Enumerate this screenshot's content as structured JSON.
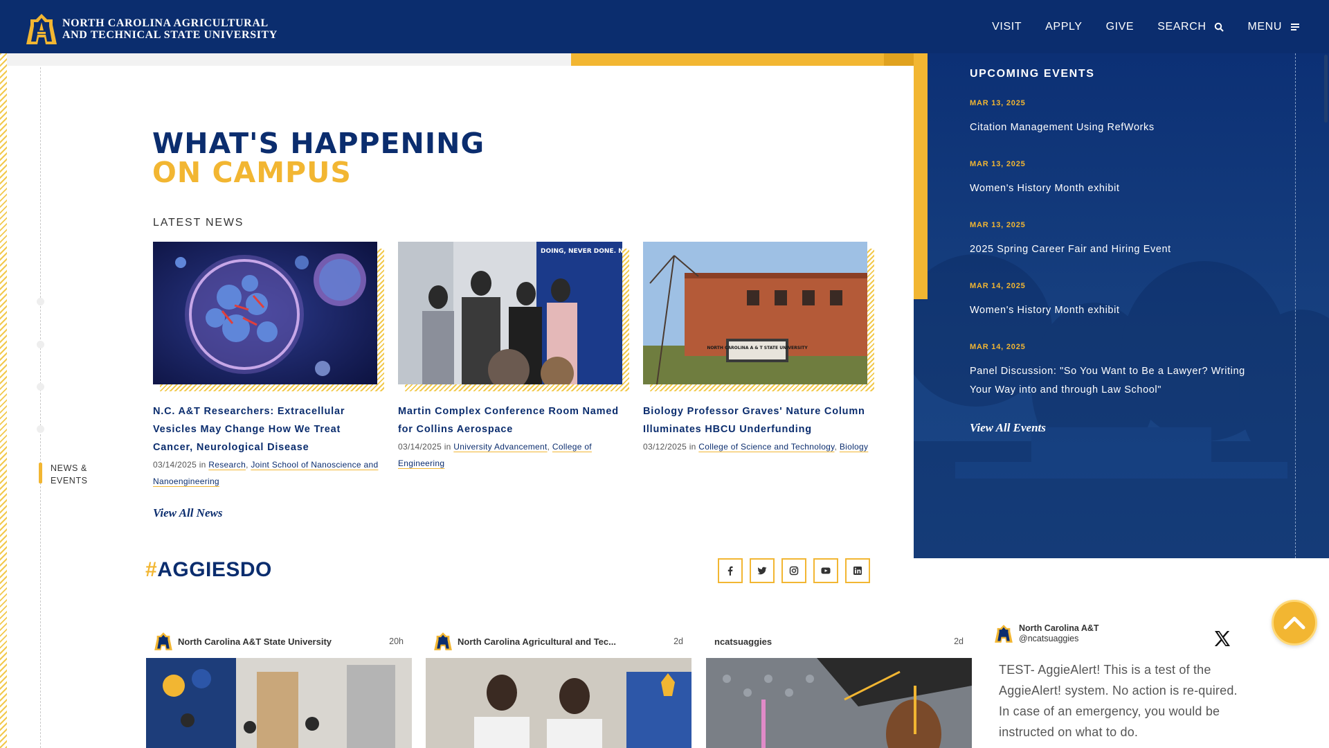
{
  "header": {
    "logo_line1": "North Carolina Agricultural",
    "logo_line2": "and Technical State University",
    "nav": [
      {
        "label": "VISIT"
      },
      {
        "label": "APPLY"
      },
      {
        "label": "GIVE"
      },
      {
        "label": "SEARCH",
        "icon": "search-icon"
      },
      {
        "label": "MENU",
        "icon": "menu-icon"
      }
    ]
  },
  "rail": {
    "active_label_line1": "NEWS &",
    "active_label_line2": "EVENTS"
  },
  "heading": {
    "line1": "WHAT'S HAPPENING",
    "line2": "ON CAMPUS"
  },
  "news": {
    "label": "LATEST NEWS",
    "view_all": "View All News",
    "items": [
      {
        "title": "N.C. A&T Researchers: Extracellular Vesicles May Change How We Treat Cancer, Neurological Disease",
        "date": "03/14/2025",
        "in": "in",
        "categories": [
          "Research",
          "Joint School of Nanoscience and Nanoengineering"
        ]
      },
      {
        "title": "Martin Complex Conference Room Named for Collins Aerospace",
        "date": "03/14/2025",
        "in": "in",
        "categories": [
          "University Advancement",
          "College of Engineering"
        ]
      },
      {
        "title": "Biology Professor Graves' Nature Column Illuminates HBCU Underfunding",
        "date": "03/12/2025",
        "in": "in",
        "categories": [
          "College of Science and Technology",
          "Biology"
        ]
      }
    ],
    "img2_banner_text": "DOING, NEVER DONE. N.C. A&T: ALWAYS DOING, NEVER DONE.",
    "img3_sign": "NORTH CAROLINA A & T STATE UNIVERSITY"
  },
  "events": {
    "heading": "UPCOMING EVENTS",
    "view_all": "View All Events",
    "items": [
      {
        "date": "MAR 13, 2025",
        "title": "Citation Management Using RefWorks"
      },
      {
        "date": "MAR 13, 2025",
        "title": "Women's History Month exhibit"
      },
      {
        "date": "MAR 13, 2025",
        "title": "2025 Spring Career Fair and Hiring Event"
      },
      {
        "date": "MAR 14, 2025",
        "title": "Women's History Month exhibit"
      },
      {
        "date": "MAR 14, 2025",
        "title": "Panel Discussion: \"So You Want to Be a Lawyer? Writing Your Way into and through Law School\""
      }
    ]
  },
  "social": {
    "hashtag": "#",
    "title": "AGGIESDO",
    "buttons": [
      "facebook-icon",
      "twitter-icon",
      "instagram-icon",
      "youtube-icon",
      "linkedin-icon"
    ],
    "feed": [
      {
        "name": "North Carolina A&T State University",
        "time": "20h"
      },
      {
        "name": "North Carolina Agricultural and Tec...",
        "time": "2d"
      },
      {
        "name": "ncatsuaggies",
        "time": "2d"
      }
    ],
    "tweet": {
      "name": "North Carolina A&T",
      "handle": "@ncatsuaggies",
      "text": "TEST- AggieAlert! This is a test of the AggieAlert! system. No action is re-quired. In case of an emergency, you would be instructed on what to do."
    }
  },
  "colors": {
    "navy": "#0b2d6e",
    "gold": "#f2b632"
  }
}
